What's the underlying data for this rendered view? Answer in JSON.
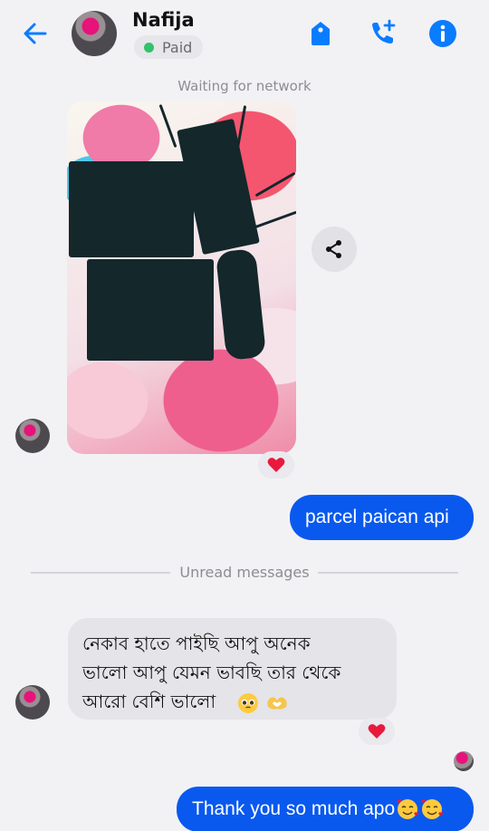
{
  "header": {
    "contact_name": "Nafija",
    "badge_label": "Paid",
    "icons": [
      "back-arrow-icon",
      "tag-icon",
      "add-call-icon",
      "info-icon"
    ]
  },
  "status_note": "Waiting for network",
  "messages": {
    "outgoing_1": "parcel paican api",
    "divider": "Unread messages",
    "incoming_1": {
      "line1": "নেকাব হাতে পাইছি আপু  অনেক",
      "line2": "ভালো আপু যেমন ভাবছি তার থেকে",
      "line3": "আরো বেশি ভালো"
    },
    "outgoing_2": "Thank you so much apo"
  },
  "colors": {
    "accent": "#0a59ee",
    "icon_blue": "#0a7cff",
    "heart": "#e8193c",
    "online": "#31c26a"
  }
}
